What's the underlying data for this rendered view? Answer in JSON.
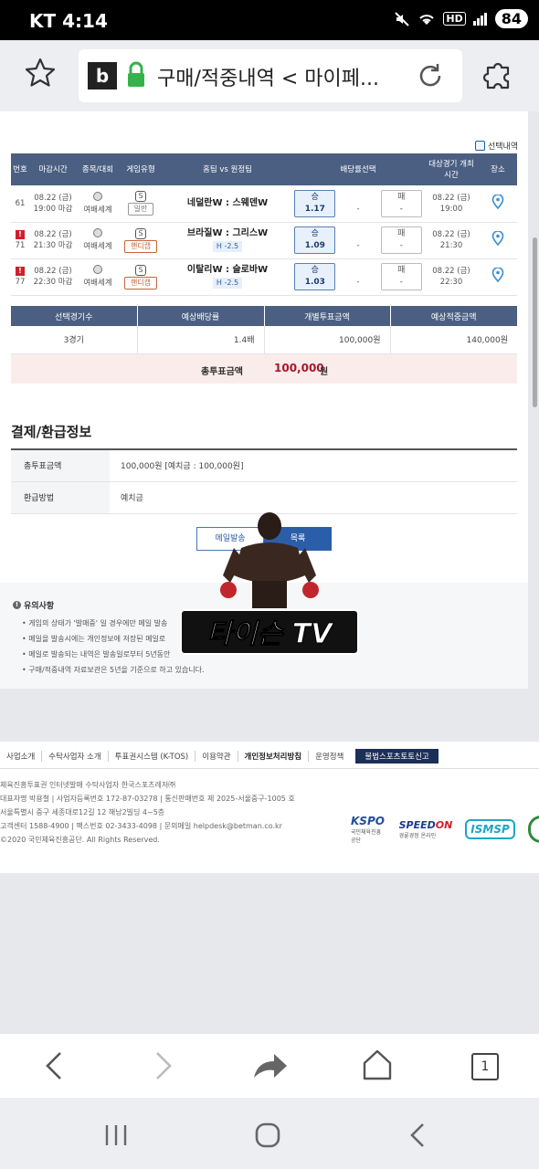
{
  "status_bar": {
    "carrier": "KT",
    "time": "4:14",
    "hd": "HD",
    "battery": "84"
  },
  "browser": {
    "site_icon": "b",
    "url_text": "구매/적중내역 < 마이페..."
  },
  "select_label": "선택내역",
  "games_table": {
    "headers": [
      "번호",
      "마감시간",
      "종목/대회",
      "게임유형",
      "홈팀 vs 원정팀",
      "배당률선택",
      "대상경기 개최시간",
      "장소"
    ],
    "rows": [
      {
        "no": "61",
        "alert": "",
        "deadline_date": "08.22 (금)",
        "deadline_time": "19:00 마감",
        "league": "여배세계",
        "type_code": "S",
        "type": "일반",
        "teams": "네덜란W : 스웨덴W",
        "handicap": "",
        "win_label": "승",
        "win_odds": "1.17",
        "draw": "-",
        "lose_label": "패",
        "lose_odds": "-",
        "match_date": "08.22 (금)",
        "match_time": "19:00"
      },
      {
        "no": "71",
        "alert": "!",
        "deadline_date": "08.22 (금)",
        "deadline_time": "21:30 마감",
        "league": "여배세계",
        "type_code": "S",
        "type": "핸디캡",
        "teams": "브라질W : 그리스W",
        "handicap": "H -2.5",
        "win_label": "승",
        "win_odds": "1.09",
        "draw": "-",
        "lose_label": "패",
        "lose_odds": "-",
        "match_date": "08.22 (금)",
        "match_time": "21:30"
      },
      {
        "no": "77",
        "alert": "!",
        "deadline_date": "08.22 (금)",
        "deadline_time": "22:30 마감",
        "league": "여배세계",
        "type_code": "S",
        "type": "핸디캡",
        "teams": "이탈리W : 슬로바W",
        "handicap": "H -2.5",
        "win_label": "승",
        "win_odds": "1.03",
        "draw": "-",
        "lose_label": "패",
        "lose_odds": "-",
        "match_date": "08.22 (금)",
        "match_time": "22:30"
      }
    ]
  },
  "summary": {
    "headers": [
      "선택경기수",
      "예상배당률",
      "개별투표금액",
      "예상적중금액"
    ],
    "values": [
      "3경기",
      "1.4배",
      "100,000원",
      "140,000원"
    ],
    "total_label": "총투표금액",
    "total_amount": "100,000",
    "total_unit": "원"
  },
  "payment": {
    "title": "결제/환급정보",
    "rows": [
      {
        "key": "총투표금액",
        "value": "100,000원 [예치금 : 100,000원]"
      },
      {
        "key": "환급방법",
        "value": "예치금"
      }
    ]
  },
  "buttons": {
    "mail": "메일발송",
    "list": "목록"
  },
  "notice": {
    "title": "유의사항",
    "items": [
      "게임의 상태가 '발매중' 일 경우에만 메일 발송",
      "메일을 발송시에는 개인정보에 저장된 메일로",
      "메일로 발송되는 내역은 발송일로부터 5년동안",
      "구매/적중내역 자료보관은 5년을 기준으로 하고 있습니다."
    ]
  },
  "watermark_text": "타이슨 TV",
  "footer": {
    "links": [
      "사업소개",
      "수탁사업자 소개",
      "투표권시스템 (K-TOS)",
      "이용약관",
      "개인정보처리방침",
      "운영정책",
      "불법스포츠토토신고"
    ],
    "info": [
      "체육진흥투표권 인터넷발매 수탁사업자 한국스포츠레저㈜",
      "대표자명 박용철  |  사업자등록번호 172-87-03278  |  통신판매번호 제 2025-서울중구-1005 호",
      "서울특별시 중구 세종대로12길 12 해남2빌딩 4~5층",
      "고객센터 1588-4900  |  팩스번호 02-3433-4098  |  문의메일 helpdesk@betman.co.kr",
      "©2020 국민체육진흥공단. All Rights Reserved."
    ],
    "logos": {
      "kspo": "KSPO",
      "kspo_sub": "국민체육진흥공단",
      "speedon_a": "SPEED",
      "speedon_b": "ON",
      "speedon_sub": "경륜경정 온라인",
      "isms": "ISMSP"
    }
  },
  "bottom_bar": {
    "tab_count": "1"
  },
  "colors": {
    "header_navy": "#4a5f82",
    "accent_blue": "#2b5ea8",
    "total_red": "#a8172a",
    "alert_red": "#d21e2b"
  }
}
